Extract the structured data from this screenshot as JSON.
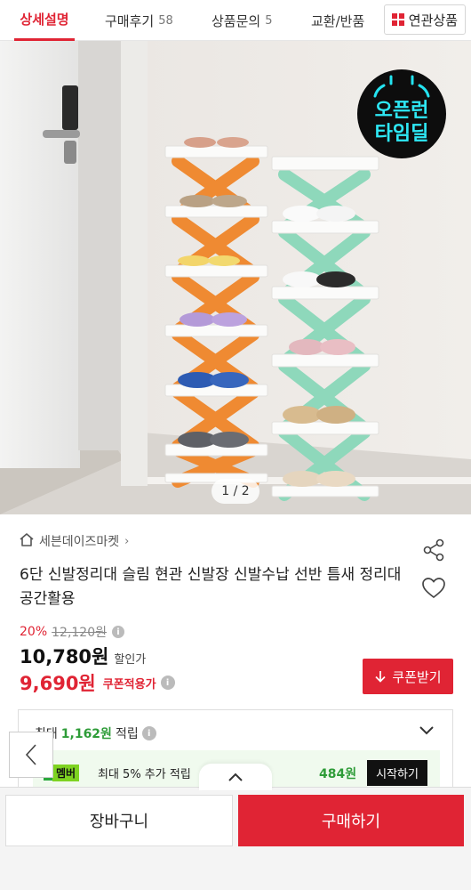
{
  "tabs": {
    "detail": "상세설명",
    "review": "구매후기",
    "review_count": "58",
    "qna": "상품문의",
    "qna_count": "5",
    "exchange": "교환/반품",
    "related": "연관상품"
  },
  "gallery": {
    "counter": "1 / 2",
    "badge_line1": "오픈런",
    "badge_line2": "타임딜"
  },
  "product": {
    "store": "세븐데이즈마켓",
    "title": "6단 신발정리대 슬림 현관 신발장 신발수납 선반 틈새 정리대 공간활용",
    "discount_percent": "20%",
    "original_price": "12,120원",
    "sale_price": "10,780원",
    "sale_label": "할인가",
    "coupon_price": "9,690원",
    "coupon_label": "쿠폰적용가",
    "coupon_button": "쿠폰받기"
  },
  "points": {
    "prefix": "최대",
    "amount": "1,162원",
    "suffix": "적립",
    "member_badge": "멤버",
    "member_text": "최대 5% 추가 적립",
    "member_amount": "484원",
    "start_button": "시작하기"
  },
  "bottom": {
    "cart": "장바구니",
    "buy": "구매하기"
  },
  "colors": {
    "accent": "#e02434",
    "points_green": "#2e9c38",
    "rack_orange": "#ef8a32",
    "rack_mint": "#8ed8bb"
  }
}
